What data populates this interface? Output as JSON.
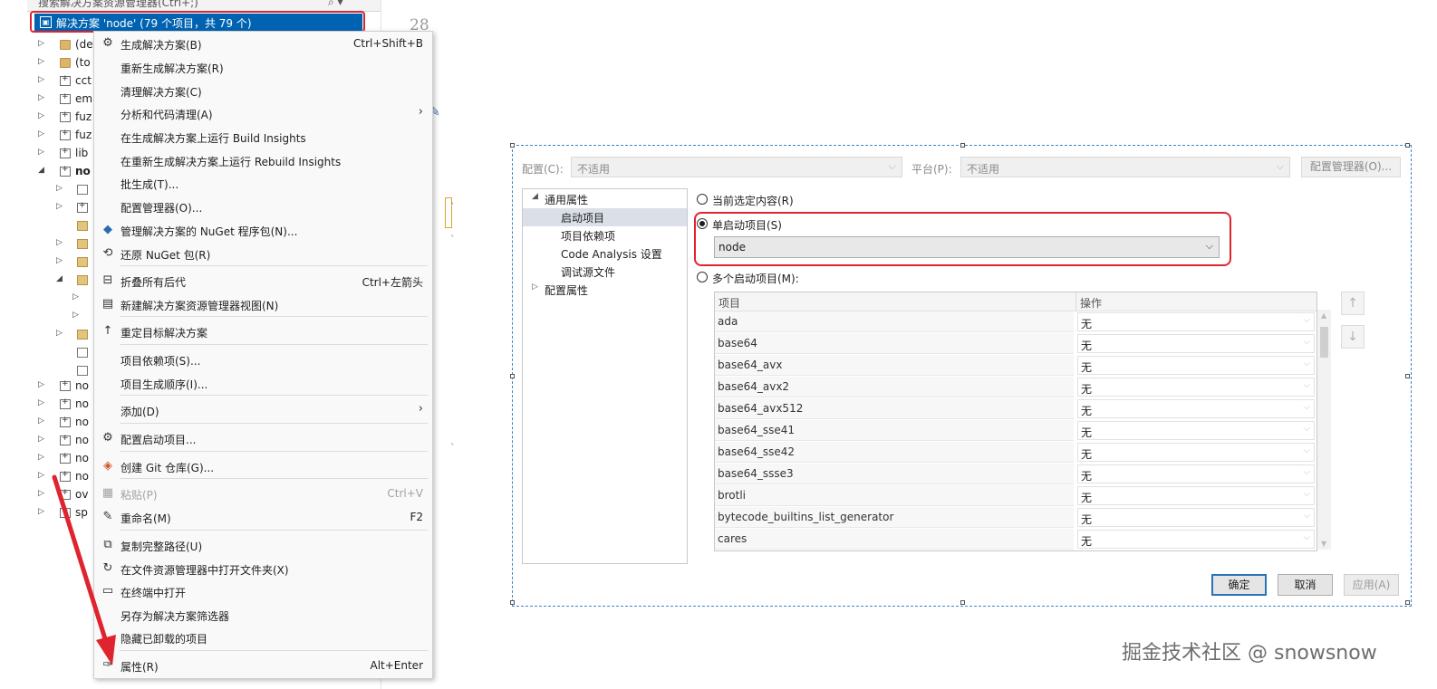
{
  "explorer": {
    "search_placeholder": "搜索解决方案资源管理器(Ctrl+;)",
    "solution_label": "解决方案 'node' (79 个项目，共 79 个)",
    "line_number": "28",
    "tree": [
      {
        "label": "(de",
        "icon": "folder-icon"
      },
      {
        "label": "(to",
        "icon": "folder-icon"
      },
      {
        "label": "cct",
        "icon": "project-icon"
      },
      {
        "label": "em",
        "icon": "project-icon"
      },
      {
        "label": "fuz",
        "icon": "project-icon"
      },
      {
        "label": "fuz",
        "icon": "project-icon"
      },
      {
        "label": "lib",
        "icon": "project-icon"
      },
      {
        "label": "no",
        "icon": "project-icon"
      },
      {
        "label": "no",
        "icon": "project-icon"
      },
      {
        "label": "no",
        "icon": "project-icon"
      },
      {
        "label": "no",
        "icon": "project-icon"
      },
      {
        "label": "no",
        "icon": "project-icon"
      },
      {
        "label": "no",
        "icon": "project-icon"
      },
      {
        "label": "no",
        "icon": "project-icon"
      },
      {
        "label": "ov",
        "icon": "project-icon"
      },
      {
        "label": "sp",
        "icon": "project-icon"
      }
    ]
  },
  "context_menu": {
    "items": [
      {
        "label": "生成解决方案(B)",
        "shortcut": "Ctrl+Shift+B",
        "icon": "build-icon"
      },
      {
        "label": "重新生成解决方案(R)",
        "shortcut": ""
      },
      {
        "label": "清理解决方案(C)",
        "shortcut": ""
      },
      {
        "label": "分析和代码清理(A)",
        "shortcut": "",
        "submenu": "›"
      },
      {
        "label": "在生成解决方案上运行 Build Insights",
        "shortcut": ""
      },
      {
        "label": "在重新生成解决方案上运行 Rebuild Insights",
        "shortcut": ""
      },
      {
        "label": "批生成(T)...",
        "shortcut": ""
      },
      {
        "label": "配置管理器(O)...",
        "shortcut": ""
      },
      {
        "label": "管理解决方案的 NuGet 程序包(N)...",
        "shortcut": "",
        "icon": "nuget-icon"
      },
      {
        "label": "还原 NuGet 包(R)",
        "shortcut": "",
        "icon": "restore-icon"
      },
      {
        "label": "折叠所有后代",
        "shortcut": "Ctrl+左箭头",
        "icon": "collapse-icon"
      },
      {
        "label": "新建解决方案资源管理器视图(N)",
        "shortcut": "",
        "icon": "new-view-icon"
      },
      {
        "label": "重定目标解决方案",
        "shortcut": "",
        "icon": "retarget-icon"
      },
      {
        "label": "项目依赖项(S)...",
        "shortcut": ""
      },
      {
        "label": "项目生成顺序(I)...",
        "shortcut": ""
      },
      {
        "label": "添加(D)",
        "shortcut": "",
        "submenu": "›"
      },
      {
        "label": "配置启动项目...",
        "shortcut": "",
        "icon": "gear-icon"
      },
      {
        "label": "创建 Git 仓库(G)...",
        "shortcut": "",
        "icon": "git-icon"
      },
      {
        "label": "粘贴(P)",
        "shortcut": "Ctrl+V",
        "icon": "paste-icon"
      },
      {
        "label": "重命名(M)",
        "shortcut": "F2",
        "icon": "rename-icon"
      },
      {
        "label": "复制完整路径(U)",
        "shortcut": "",
        "icon": "copy-icon"
      },
      {
        "label": "在文件资源管理器中打开文件夹(X)",
        "shortcut": "",
        "icon": "open-folder-icon"
      },
      {
        "label": "在终端中打开",
        "shortcut": "",
        "icon": "terminal-icon"
      },
      {
        "label": "另存为解决方案筛选器",
        "shortcut": ""
      },
      {
        "label": "隐藏已卸载的项目",
        "shortcut": ""
      },
      {
        "label": "属性(R)",
        "shortcut": "Alt+Enter",
        "icon": "wrench-icon"
      }
    ]
  },
  "dialog": {
    "config_label": "配置(C):",
    "config_value": "不适用",
    "platform_label": "平台(P):",
    "platform_value": "不适用",
    "config_manager_button": "配置管理器(O)...",
    "nav": {
      "common": "通用属性",
      "startup": "启动项目",
      "deps": "项目依赖项",
      "code_analysis": "Code Analysis 设置",
      "debug_source": "调试源文件",
      "config_props": "配置属性"
    },
    "radio_current": "当前选定内容(R)",
    "radio_single": "单启动项目(S)",
    "single_value": "node",
    "radio_multiple": "多个启动项目(M):",
    "grid": {
      "col_project": "项目",
      "col_action": "操作",
      "rows": [
        {
          "name": "ada",
          "action": "无"
        },
        {
          "name": "base64",
          "action": "无"
        },
        {
          "name": "base64_avx",
          "action": "无"
        },
        {
          "name": "base64_avx2",
          "action": "无"
        },
        {
          "name": "base64_avx512",
          "action": "无"
        },
        {
          "name": "base64_sse41",
          "action": "无"
        },
        {
          "name": "base64_sse42",
          "action": "无"
        },
        {
          "name": "base64_ssse3",
          "action": "无"
        },
        {
          "name": "brotli",
          "action": "无"
        },
        {
          "name": "bytecode_builtins_list_generator",
          "action": "无"
        },
        {
          "name": "cares",
          "action": "无"
        }
      ]
    },
    "ok": "确定",
    "cancel": "取消",
    "apply": "应用(A)"
  },
  "watermark": "掘金技术社区 @ snowsnow",
  "colors": {
    "highlight_red": "#e0242f",
    "selection_blue": "#0063b1",
    "dialog_border": "#3a86c8"
  }
}
